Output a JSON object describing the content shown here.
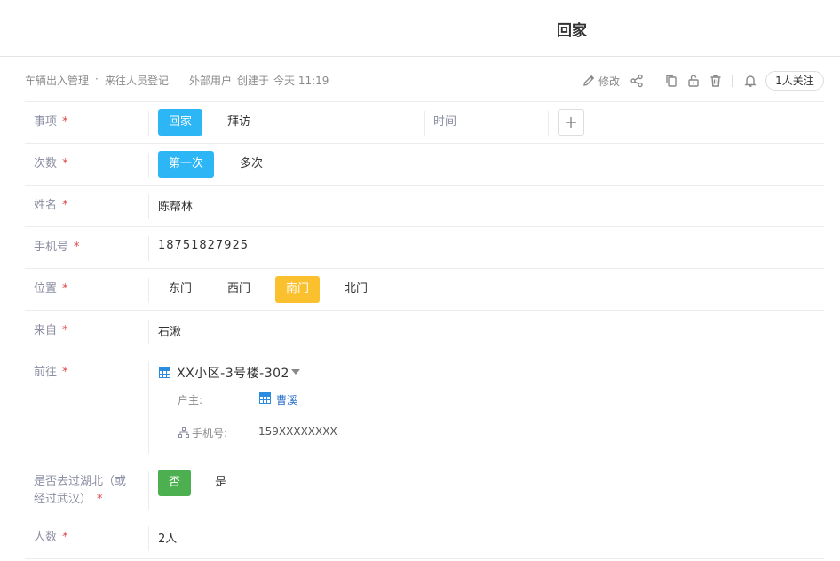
{
  "page": {
    "title": "回家"
  },
  "breadcrumb": {
    "app": "车辆出入管理",
    "sheet": "来往人员登记",
    "creator": "外部用户",
    "created_prefix": "创建于",
    "created_time": "今天 11:19"
  },
  "toolbar": {
    "edit_label": "修改",
    "follow_label": "1人关注",
    "icons": [
      "pencil-icon",
      "share-icon",
      "copy-icon",
      "unlock-icon",
      "trash-icon",
      "bell-icon"
    ]
  },
  "form": {
    "item": {
      "label": "事项",
      "options": [
        "回家",
        "拜访"
      ],
      "selected": "回家",
      "time_label": "时间"
    },
    "count": {
      "label": "次数",
      "options": [
        "第一次",
        "多次"
      ],
      "selected": "第一次"
    },
    "name": {
      "label": "姓名",
      "value": "陈帮林"
    },
    "phone": {
      "label": "手机号",
      "value": "18751827925"
    },
    "location": {
      "label": "位置",
      "options": [
        "东门",
        "西门",
        "南门",
        "北门"
      ],
      "selected": "南门"
    },
    "from": {
      "label": "来自",
      "value": "石湫"
    },
    "destination": {
      "label": "前往",
      "value": "XX小区-3号楼-302",
      "owner_label": "户主:",
      "owner_value": "曹溪",
      "owner_phone_label": "手机号:",
      "owner_phone_value": "159XXXXXXXX"
    },
    "hubei": {
      "label_line1": "是否去过湖北（或",
      "label_line2": "经过武汉）",
      "options": [
        "否",
        "是"
      ],
      "selected": "否"
    },
    "people": {
      "label": "人数",
      "value": "2人"
    },
    "required_mark": "*"
  },
  "colors": {
    "accent_blue": "#2db6f5",
    "accent_yellow": "#fbc02d",
    "accent_green": "#4caf50",
    "label_gray": "#8c8fa3",
    "required_red": "#e04646",
    "link_blue": "#2a6fc9"
  }
}
